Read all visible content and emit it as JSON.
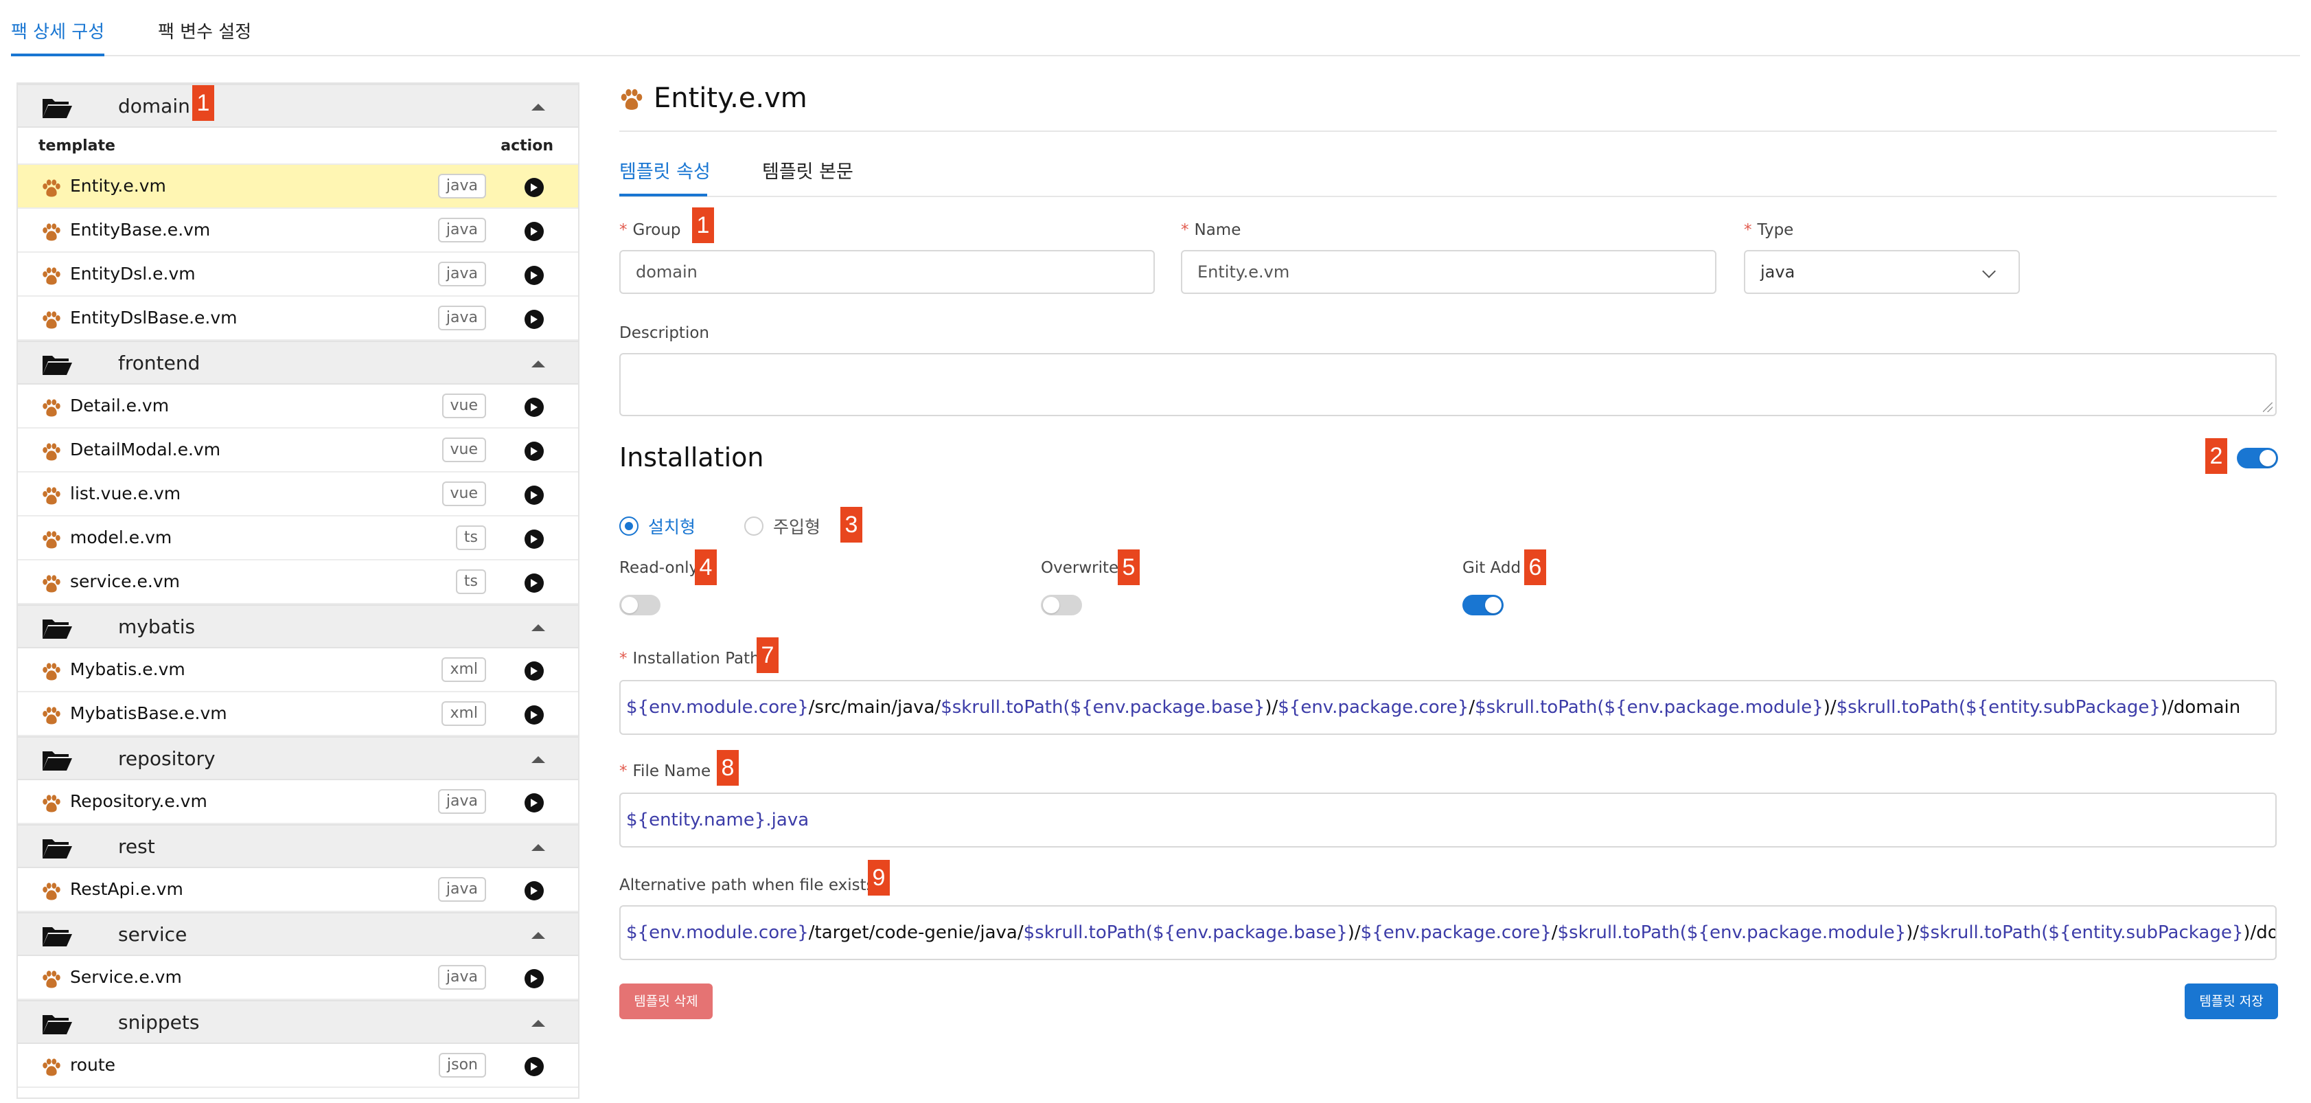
{
  "top_tabs": [
    {
      "label": "팩 상세 구성",
      "active": true
    },
    {
      "label": "팩 변수 설정",
      "active": false
    }
  ],
  "tree": {
    "column_template": "template",
    "column_action": "action",
    "groups": [
      {
        "name": "domain",
        "items": [
          {
            "name": "Entity.e.vm",
            "type": "java",
            "selected": true
          },
          {
            "name": "EntityBase.e.vm",
            "type": "java"
          },
          {
            "name": "EntityDsl.e.vm",
            "type": "java"
          },
          {
            "name": "EntityDslBase.e.vm",
            "type": "java"
          }
        ]
      },
      {
        "name": "frontend",
        "items": [
          {
            "name": "Detail.e.vm",
            "type": "vue"
          },
          {
            "name": "DetailModal.e.vm",
            "type": "vue"
          },
          {
            "name": "list.vue.e.vm",
            "type": "vue"
          },
          {
            "name": "model.e.vm",
            "type": "ts"
          },
          {
            "name": "service.e.vm",
            "type": "ts"
          }
        ]
      },
      {
        "name": "mybatis",
        "items": [
          {
            "name": "Mybatis.e.vm",
            "type": "xml"
          },
          {
            "name": "MybatisBase.e.vm",
            "type": "xml"
          }
        ]
      },
      {
        "name": "repository",
        "items": [
          {
            "name": "Repository.e.vm",
            "type": "java"
          }
        ]
      },
      {
        "name": "rest",
        "items": [
          {
            "name": "RestApi.e.vm",
            "type": "java"
          }
        ]
      },
      {
        "name": "service",
        "items": [
          {
            "name": "Service.e.vm",
            "type": "java"
          }
        ]
      },
      {
        "name": "snippets",
        "items": [
          {
            "name": "route",
            "type": "json"
          }
        ]
      }
    ]
  },
  "detail": {
    "title": "Entity.e.vm",
    "tabs": [
      {
        "label": "템플릿 속성",
        "active": true
      },
      {
        "label": "템플릿 본문",
        "active": false
      }
    ],
    "group": {
      "label": "Group",
      "value": "domain"
    },
    "name": {
      "label": "Name",
      "value": "Entity.e.vm"
    },
    "type": {
      "label": "Type",
      "value": "java"
    },
    "description": {
      "label": "Description",
      "value": ""
    },
    "installation": {
      "title": "Installation",
      "enabled": true,
      "mode_options": [
        {
          "label": "설치형",
          "checked": true
        },
        {
          "label": "주입형",
          "checked": false
        }
      ],
      "read_only": {
        "label": "Read-only",
        "on": false
      },
      "overwrite": {
        "label": "Overwrite",
        "on": false
      },
      "git_add": {
        "label": "Git Add",
        "on": true
      }
    },
    "installation_path": {
      "label": "Installation Path",
      "segments": [
        {
          "t": "${env.module.core}",
          "v": true
        },
        {
          "t": "/src/main/java/",
          "v": false
        },
        {
          "t": "$skrull.toPath(",
          "v": true
        },
        {
          "t": "${env.package.base}",
          "v": true
        },
        {
          "t": ")/",
          "v": false
        },
        {
          "t": "${env.package.core}",
          "v": true
        },
        {
          "t": "/",
          "v": false
        },
        {
          "t": "$skrull.toPath(",
          "v": true
        },
        {
          "t": "${env.package.module}",
          "v": true
        },
        {
          "t": ")/",
          "v": false
        },
        {
          "t": "$skrull.toPath(",
          "v": true
        },
        {
          "t": "${entity.subPackage}",
          "v": true
        },
        {
          "t": ")/domain",
          "v": false
        }
      ]
    },
    "file_name": {
      "label": "File Name",
      "segments": [
        {
          "t": "${entity.name}.java",
          "v": true
        }
      ]
    },
    "alt_path": {
      "label": "Alternative path when file exists",
      "segments": [
        {
          "t": "${env.module.core}",
          "v": true
        },
        {
          "t": "/target/code-genie/java/",
          "v": false
        },
        {
          "t": "$skrull.toPath(",
          "v": true
        },
        {
          "t": "${env.package.base}",
          "v": true
        },
        {
          "t": ")/",
          "v": false
        },
        {
          "t": "${env.package.core}",
          "v": true
        },
        {
          "t": "/",
          "v": false
        },
        {
          "t": "$skrull.toPath(",
          "v": true
        },
        {
          "t": "${env.package.module}",
          "v": true
        },
        {
          "t": ")/",
          "v": false
        },
        {
          "t": "$skrull.toPath(",
          "v": true
        },
        {
          "t": "${entity.subPackage}",
          "v": true
        },
        {
          "t": ")/domain",
          "v": false
        }
      ]
    },
    "delete_button": "템플릿 삭제",
    "save_button": "템플릿 저장"
  },
  "markers": [
    "1",
    "1",
    "2",
    "3",
    "4",
    "5",
    "6",
    "7",
    "8",
    "9"
  ],
  "colors": {
    "accent": "#1976d2",
    "marker": "#e8461e",
    "selected_row": "#fff6b3",
    "delete": "#e57373",
    "variable": "#3c3ca8"
  }
}
